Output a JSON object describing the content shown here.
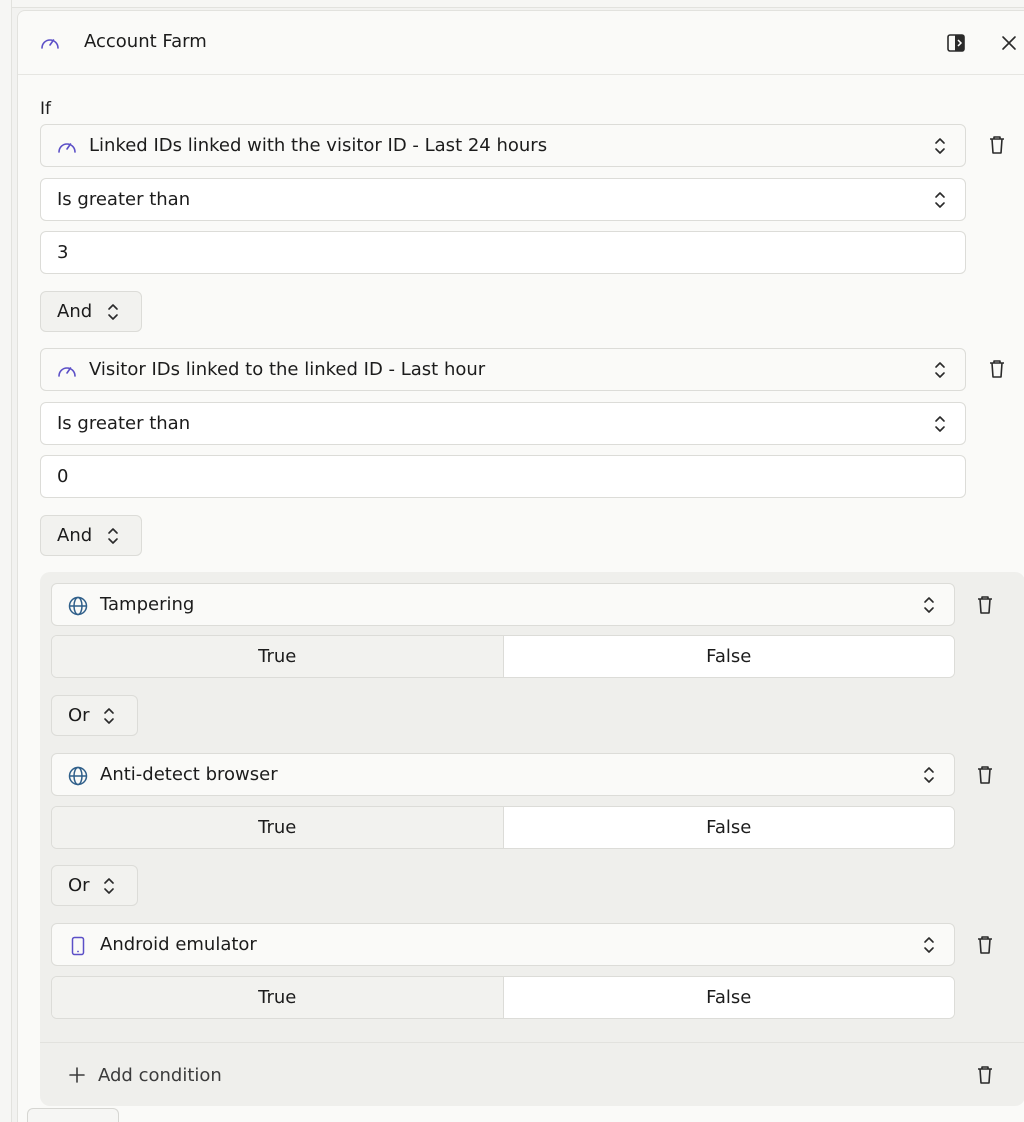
{
  "panel": {
    "title": "Account Farm",
    "title_icon": "gauge-icon",
    "toggle_sidebar_icon": "sidebar-toggle-icon",
    "close_icon": "close-icon"
  },
  "rule": {
    "if_label": "If",
    "conditions": [
      {
        "icon": "gauge-icon",
        "signal": "Linked IDs linked with the visitor ID - Last 24 hours",
        "operator": "Is greater than",
        "value": "3"
      },
      {
        "icon": "gauge-icon",
        "signal": "Visitor IDs linked to the linked ID - Last hour",
        "operator": "Is greater than",
        "value": "0"
      }
    ],
    "conjunctions": [
      "And",
      "And"
    ],
    "group": {
      "items": [
        {
          "icon": "globe-icon",
          "signal": "Tampering",
          "true_label": "True",
          "false_label": "False",
          "selected": "False"
        },
        {
          "icon": "globe-icon",
          "signal": "Anti-detect browser",
          "true_label": "True",
          "false_label": "False",
          "selected": "False"
        },
        {
          "icon": "phone-icon",
          "signal": "Android emulator",
          "true_label": "True",
          "false_label": "False",
          "selected": "False"
        }
      ],
      "conjunctions": [
        "Or",
        "Or"
      ],
      "add_condition_label": "Add condition"
    }
  },
  "colors": {
    "icon_accent": "#5b4fc7",
    "globe_icon": "#2f5f8a",
    "border": "#dcdcd8",
    "panel_bg": "#fafaf8",
    "group_bg": "#efefec"
  }
}
